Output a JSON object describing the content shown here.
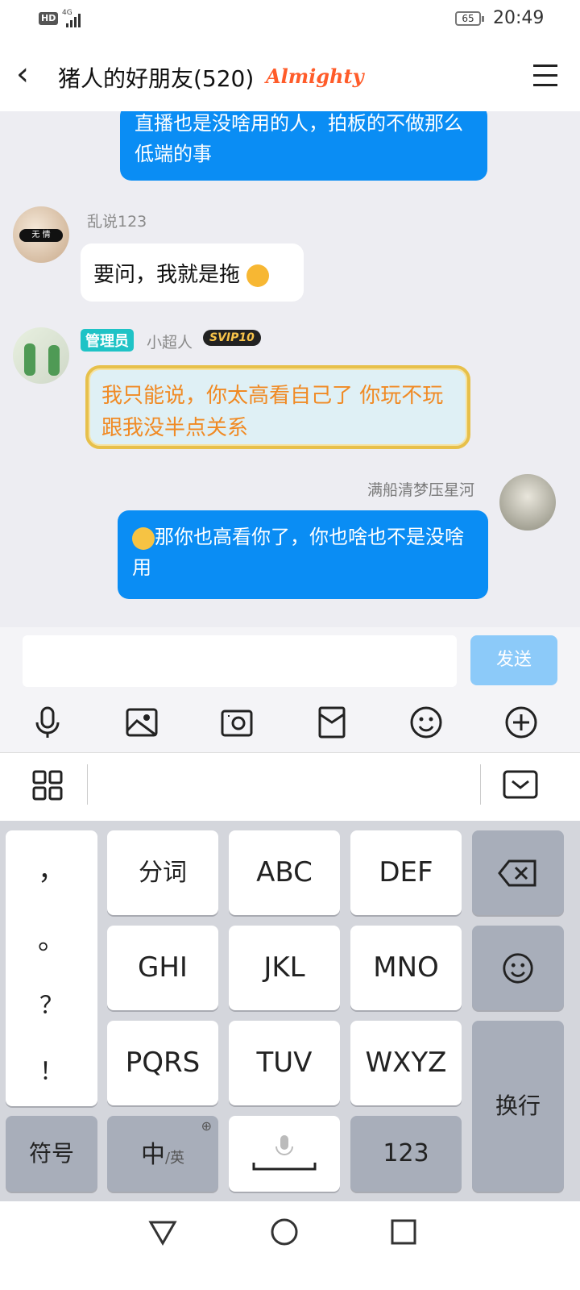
{
  "status": {
    "hd": "HD",
    "net": "4G",
    "battery": "65",
    "time": "20:49"
  },
  "header": {
    "title": "猪人的好朋友(520)",
    "badge": "Almighty"
  },
  "messages": {
    "m1": {
      "text": "直播也是没啥用的人，拍板的不做那么低端的事"
    },
    "m2": {
      "nick": "乱说123",
      "text": "要问，我就是拖",
      "avatar_text": "无 情"
    },
    "m3": {
      "badge": "管理员",
      "nick": "小超人",
      "vip": "SVIP10",
      "text": "我只能说，你太高看自己了 你玩不玩跟我没半点关系"
    },
    "m4": {
      "nick": "满船清梦压星河",
      "text": "那你也高看你了，你也啥也不是没啥用"
    }
  },
  "input": {
    "placeholder": "",
    "send": "发送"
  },
  "keyboard": {
    "punct": [
      "，",
      "。",
      "？",
      "！"
    ],
    "row1": [
      "分词",
      "ABC",
      "DEF"
    ],
    "row2": [
      "GHI",
      "JKL",
      "MNO"
    ],
    "row3": [
      "PQRS",
      "TUV",
      "WXYZ"
    ],
    "symbols": "符号",
    "lang_main": "中",
    "lang_sub": "/英",
    "num": "123",
    "enter": "换行"
  },
  "colors": {
    "accent": "#0a8df4",
    "send_disabled": "#8ccaf9",
    "admin": "#1fc3c6"
  }
}
